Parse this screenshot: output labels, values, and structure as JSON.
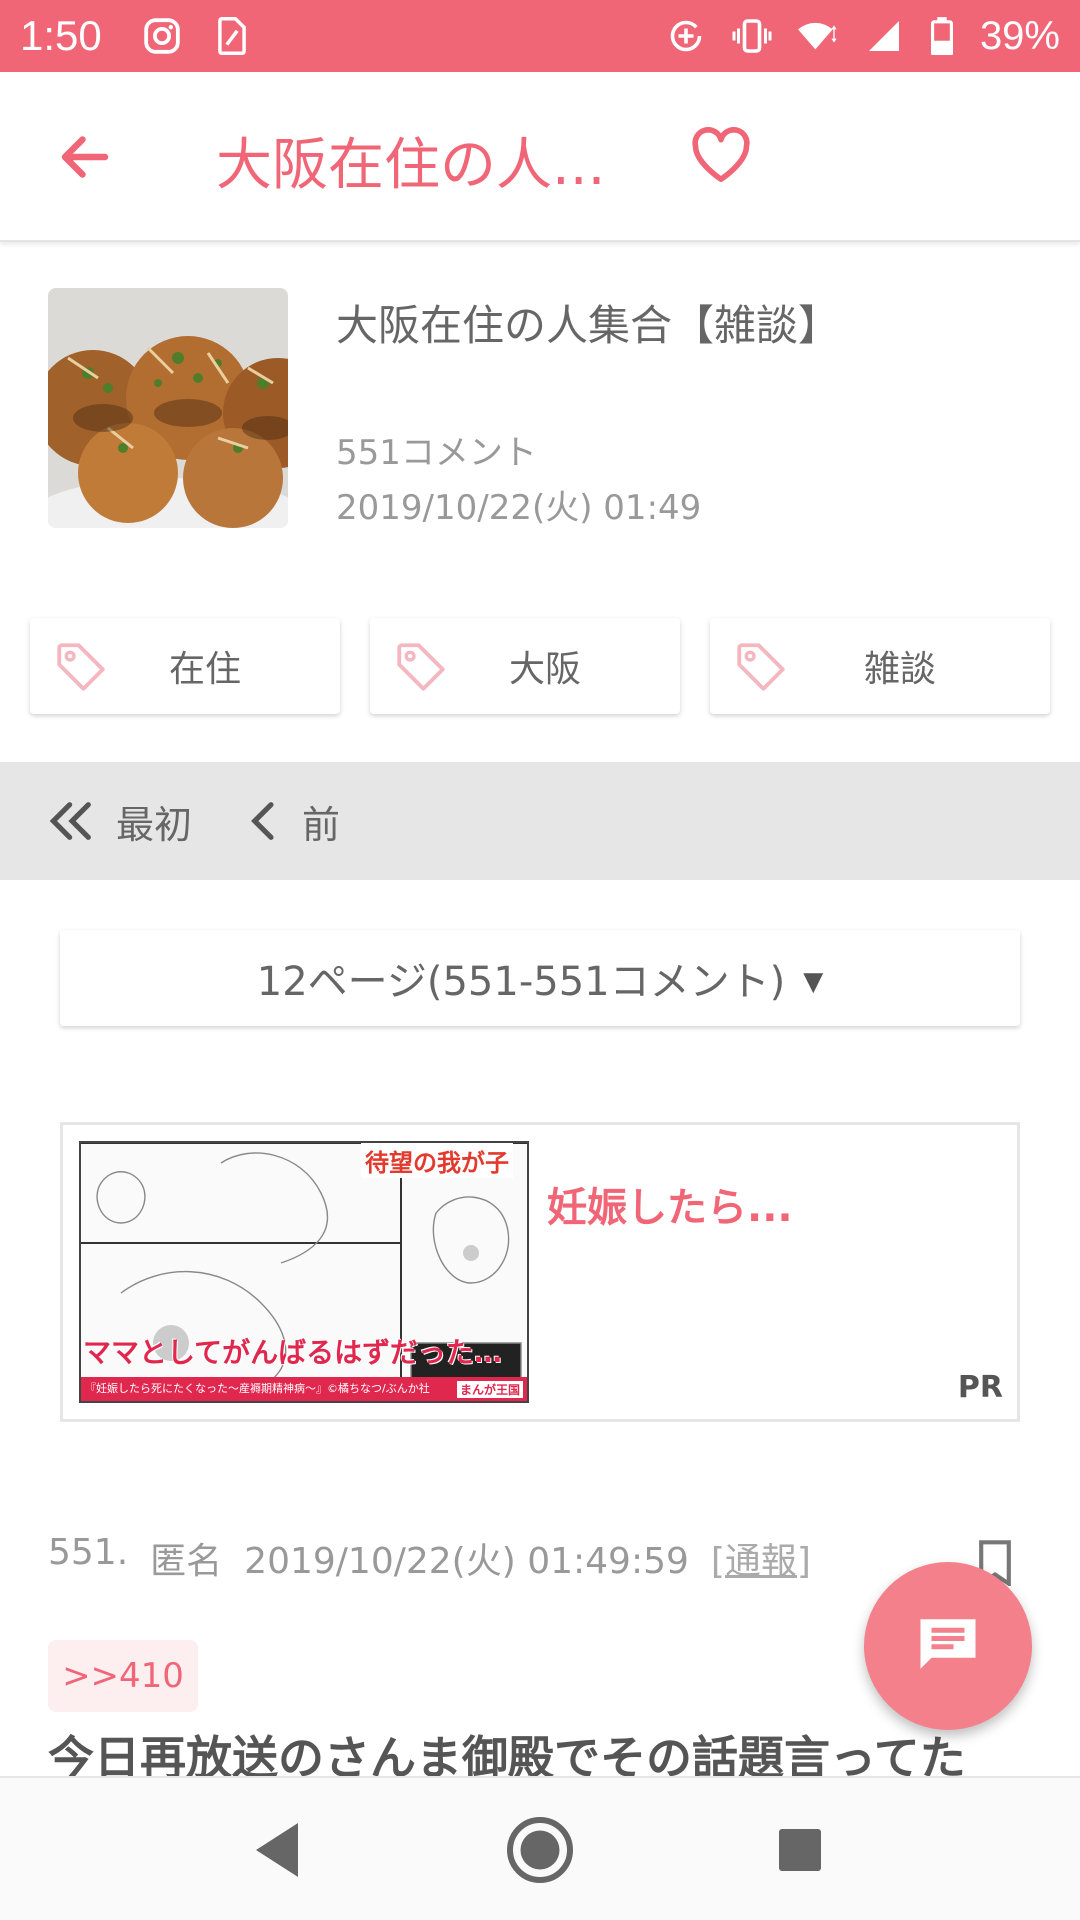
{
  "status_bar": {
    "time": "1:50",
    "battery": "39%",
    "icons": [
      "instagram-icon",
      "sim-card-icon",
      "data-saver-icon",
      "vibrate-icon",
      "wifi-icon",
      "signal-icon",
      "battery-icon"
    ]
  },
  "app_bar": {
    "title": "大阪在住の人...",
    "icons": [
      "back-arrow-icon",
      "heart-icon"
    ]
  },
  "thread": {
    "title": "大阪在住の人集合【雑談】",
    "comment_count": "551コメント",
    "date": "2019/10/22(火) 01:49"
  },
  "tags": [
    "在住",
    "大阪",
    "雑談"
  ],
  "pager": {
    "first_label": "最初",
    "prev_label": "前"
  },
  "page_select": {
    "selected": "12ページ(551-551コメント)"
  },
  "ad": {
    "title": "妊娠したら...",
    "badge": "PR",
    "image_texts": [
      "待望の我が子",
      "ママとしてがんばるはずだった…",
      "『妊娠したら死にたくなった〜産褥期精神病〜』©橘ちなつ/ぶんか社",
      "まんが王国"
    ]
  },
  "comment": {
    "number": "551.",
    "author": "匿名",
    "datetime": "2019/10/22(火) 01:49:59",
    "report": "[通報]",
    "reply_to": ">>410",
    "body": "今日再放送のさんま御殿でその話題言ってた"
  },
  "colors": {
    "accent": "#f06677",
    "fab": "#f4808c",
    "pager_bg": "#e6e6e6"
  }
}
